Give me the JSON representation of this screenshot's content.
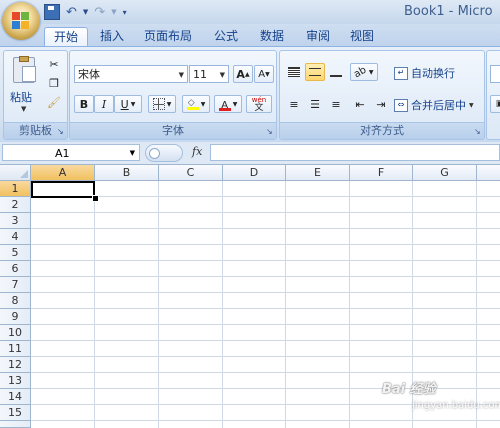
{
  "title_bar": {
    "document_title": "Book1 - Micro"
  },
  "quick_access": {
    "save_icon": "save-icon",
    "undo_icon": "undo-icon",
    "redo_icon": "redo-icon",
    "customize_icon": "customize-qat-icon"
  },
  "tabs": [
    {
      "label": "开始",
      "active": true
    },
    {
      "label": "插入",
      "active": false
    },
    {
      "label": "页面布局",
      "active": false
    },
    {
      "label": "公式",
      "active": false
    },
    {
      "label": "数据",
      "active": false
    },
    {
      "label": "审阅",
      "active": false
    },
    {
      "label": "视图",
      "active": false
    }
  ],
  "clipboard": {
    "paste_label": "粘贴",
    "group_label": "剪贴板"
  },
  "font": {
    "font_name": "宋体",
    "font_size": "11",
    "bold": "B",
    "italic": "I",
    "underline": "U",
    "grow": "A",
    "shrink": "A",
    "font_color_letter": "A",
    "wen_char": "wén",
    "wen_base": "文",
    "group_label": "字体"
  },
  "alignment": {
    "wrap_text_label": "自动换行",
    "merge_center_label": "合并后居中",
    "group_label": "对齐方式"
  },
  "formula_bar": {
    "name_box_value": "A1",
    "fx_label": "fx",
    "formula_value": ""
  },
  "columns": [
    "A",
    "B",
    "C",
    "D",
    "E",
    "F",
    "G"
  ],
  "rows": [
    "1",
    "2",
    "3",
    "4",
    "5",
    "6",
    "7",
    "8",
    "9",
    "10",
    "11",
    "12",
    "13",
    "14",
    "15"
  ],
  "selected_cell": "A1",
  "watermark": {
    "brand": "Bai 经验",
    "url": "jingyan.baidu.com"
  },
  "colors": {
    "ribbon_blue": "#d7e4f3",
    "selection": "#f1c15f",
    "font_color_red": "#e02020",
    "highlight_yellow": "#ffff00"
  }
}
